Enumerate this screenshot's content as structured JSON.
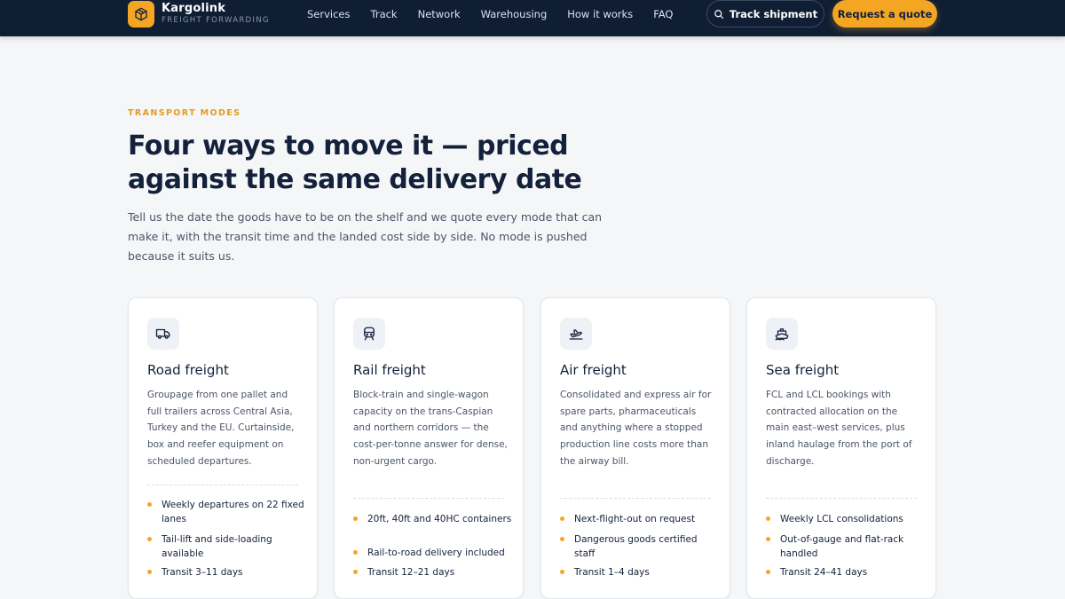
{
  "brand": {
    "name": "Kargolink",
    "tagline": "FREIGHT FORWARDING"
  },
  "nav": {
    "items": [
      "Services",
      "Track",
      "Network",
      "Warehousing",
      "How it works",
      "FAQ"
    ]
  },
  "header": {
    "track_label": "Track shipment",
    "quote_label": "Request a quote"
  },
  "intro": {
    "eyebrow": "TRANSPORT MODES",
    "headline": "Four ways to move it — priced against the same delivery date",
    "lede": "Tell us the date the goods have to be on the shelf and we quote every mode that can make it, with the transit time and the landed cost side by side. No mode is pushed because it suits us."
  },
  "colors": {
    "navy": "#0f1e33",
    "accent": "#f5a524",
    "ink": "#14213a"
  },
  "cards": [
    {
      "icon": "truck-icon",
      "title": "Road freight",
      "description": "Groupage from one pallet and full trailers across Central Asia, Turkey and the EU. Curtainside, box and reefer equipment on scheduled departures.",
      "features": [
        "Weekly departures on 22 fixed lanes",
        "Tail-lift and side-loading available",
        "Transit 3–11 days"
      ]
    },
    {
      "icon": "train-icon",
      "title": "Rail freight",
      "description": "Block-train and single-wagon capacity on the trans-Caspian and northern corridors — the cost-per-tonne answer for dense, non-urgent cargo.",
      "features": [
        "20ft, 40ft and 40HC containers",
        "Rail-to-road delivery included",
        "Transit 12–21 days"
      ]
    },
    {
      "icon": "plane-icon",
      "title": "Air freight",
      "description": "Consolidated and express air for spare parts, pharmaceuticals and anything where a stopped production line costs more than the airway bill.",
      "features": [
        "Next-flight-out on request",
        "Dangerous goods certified staff",
        "Transit 1–4 days"
      ]
    },
    {
      "icon": "ship-icon",
      "title": "Sea freight",
      "description": "FCL and LCL bookings with contracted allocation on the main east–west services, plus inland haulage from the port of discharge.",
      "features": [
        "Weekly LCL consolidations",
        "Out-of-gauge and flat-rack handled",
        "Transit 24–41 days"
      ]
    }
  ]
}
